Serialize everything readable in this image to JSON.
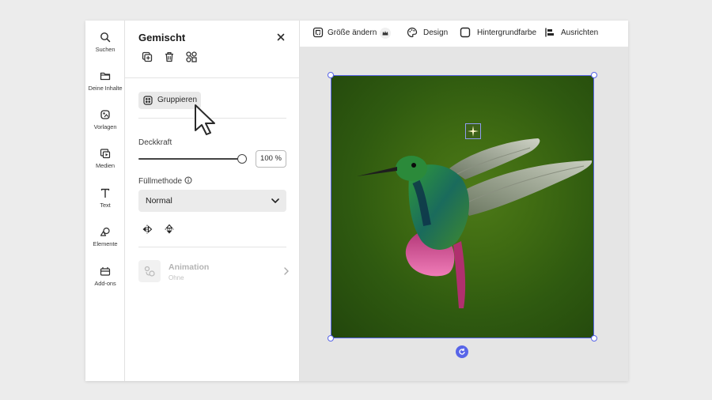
{
  "rail": {
    "items": [
      {
        "label": "Suchen",
        "icon": "search-icon"
      },
      {
        "label": "Deine Inhalte",
        "icon": "folder-icon"
      },
      {
        "label": "Vorlagen",
        "icon": "templates-icon"
      },
      {
        "label": "Medien",
        "icon": "media-icon"
      },
      {
        "label": "Text",
        "icon": "text-icon"
      },
      {
        "label": "Elemente",
        "icon": "shapes-icon"
      },
      {
        "label": "Add-ons",
        "icon": "addons-icon"
      }
    ]
  },
  "panel": {
    "title": "Gemischt",
    "group_label": "Gruppieren",
    "opacity_label": "Deckkraft",
    "opacity_value": "100 %",
    "opacity_level": 1.0,
    "blend_label": "Füllmethode",
    "blend_value": "Normal",
    "animation_title": "Animation",
    "animation_sub": "Ohne"
  },
  "toolbar": {
    "resize": "Größe ändern",
    "design": "Design",
    "background": "Hintergrundfarbe",
    "align": "Ausrichten"
  },
  "colors": {
    "accent": "#5865e8",
    "panel_bg": "#ffffff",
    "canvas_bg": "#e5e5e5"
  }
}
